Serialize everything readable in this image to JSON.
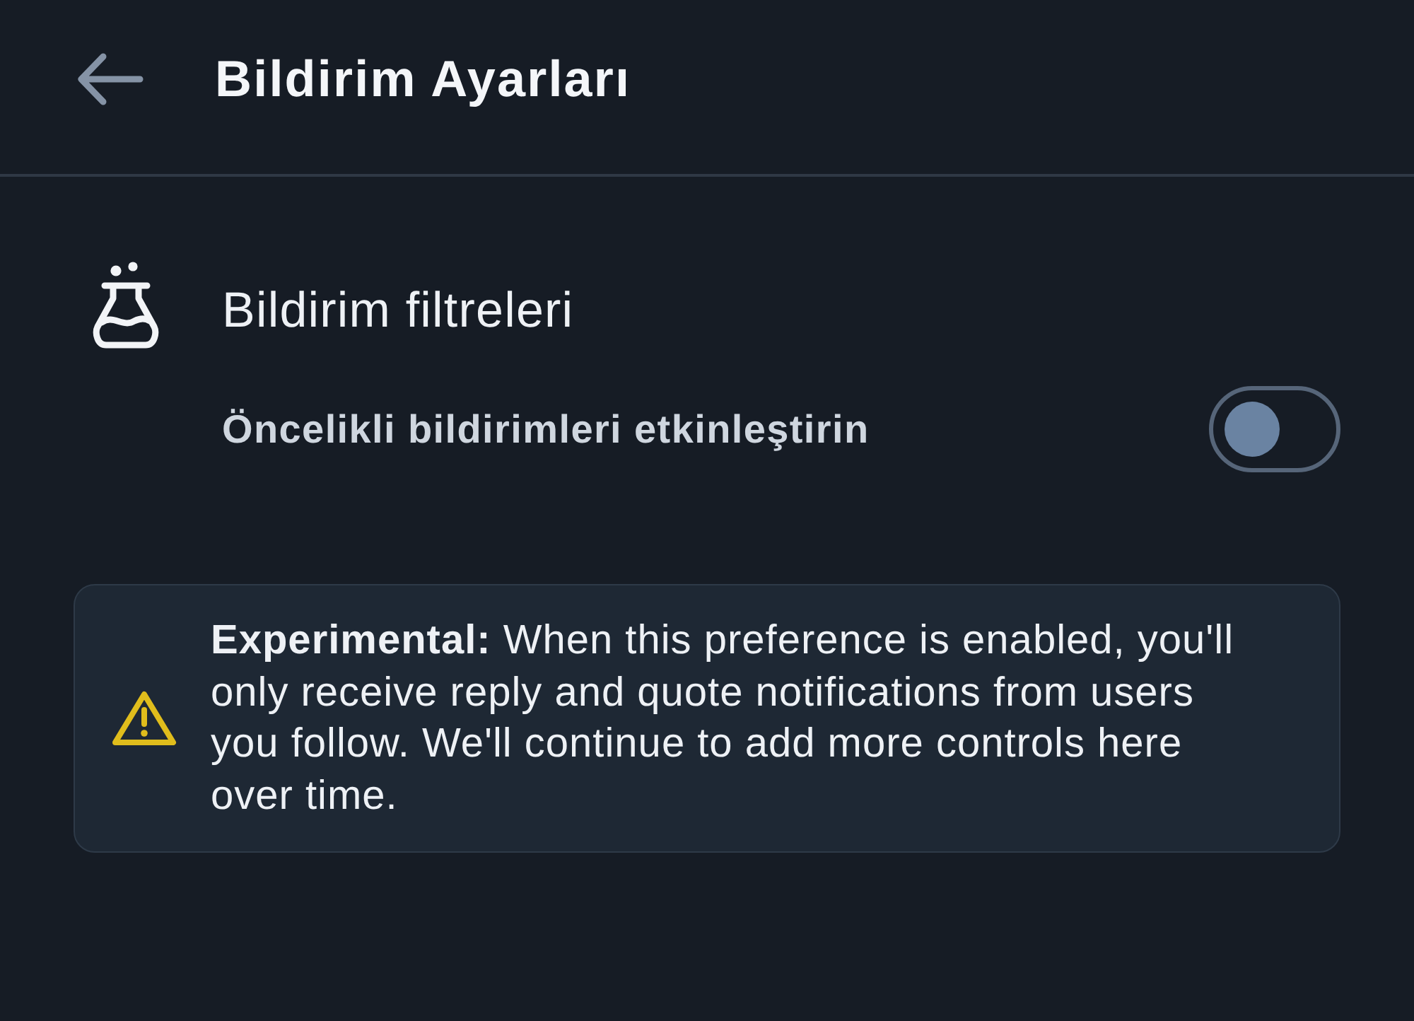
{
  "header": {
    "title": "Bildirim Ayarları"
  },
  "section": {
    "title": "Bildirim filtreleri",
    "settings": [
      {
        "label": "Öncelikli bildirimleri etkinleştirin",
        "on": false
      }
    ]
  },
  "notice": {
    "text": "**Experimental:** When this preference is enabled, you'll only receive reply and quote notifications from users you follow. We'll continue to add more controls here over time."
  }
}
